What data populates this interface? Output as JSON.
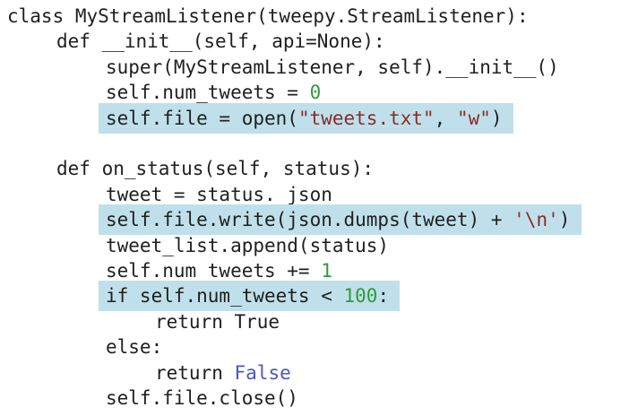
{
  "code": {
    "lines": [
      {
        "indent": 0,
        "parts": [
          {
            "t": "class MyStreamListener(tweepy.StreamListener):",
            "c": ""
          }
        ]
      },
      {
        "indent": 1,
        "parts": [
          {
            "t": "def __init__(self, api=None):",
            "c": ""
          }
        ]
      },
      {
        "indent": 2,
        "parts": [
          {
            "t": "super(MyStreamListener, self).__init__()",
            "c": ""
          }
        ]
      },
      {
        "indent": 2,
        "parts": [
          {
            "t": "self.num_tweets = ",
            "c": ""
          },
          {
            "t": "0",
            "c": "num"
          }
        ]
      },
      {
        "indent": 2,
        "parts": [
          {
            "t": "self.file = open(",
            "c": ""
          },
          {
            "t": "\"tweets.txt\"",
            "c": "str"
          },
          {
            "t": ", ",
            "c": ""
          },
          {
            "t": "\"w\"",
            "c": "str"
          },
          {
            "t": ")",
            "c": ""
          }
        ]
      },
      {
        "indent": 0,
        "parts": [
          {
            "t": "",
            "c": ""
          }
        ]
      },
      {
        "indent": 1,
        "parts": [
          {
            "t": "def on_status(self, status):",
            "c": ""
          }
        ]
      },
      {
        "indent": 2,
        "parts": [
          {
            "t": "tweet = status._json",
            "c": ""
          }
        ]
      },
      {
        "indent": 2,
        "parts": [
          {
            "t": "self.file.write(json.dumps(tweet) + ",
            "c": ""
          },
          {
            "t": "'\\n'",
            "c": "str"
          },
          {
            "t": ")",
            "c": ""
          }
        ]
      },
      {
        "indent": 2,
        "parts": [
          {
            "t": "tweet_list.append(status)",
            "c": ""
          }
        ]
      },
      {
        "indent": 2,
        "parts": [
          {
            "t": "self.num_tweets += ",
            "c": ""
          },
          {
            "t": "1",
            "c": "num"
          }
        ]
      },
      {
        "indent": 2,
        "parts": [
          {
            "t": "if self.num_tweets < ",
            "c": ""
          },
          {
            "t": "100",
            "c": "num"
          },
          {
            "t": ":",
            "c": ""
          }
        ]
      },
      {
        "indent": 3,
        "parts": [
          {
            "t": "return True",
            "c": ""
          }
        ]
      },
      {
        "indent": 2,
        "parts": [
          {
            "t": "else:",
            "c": ""
          }
        ]
      },
      {
        "indent": 3,
        "parts": [
          {
            "t": "return ",
            "c": ""
          },
          {
            "t": "False",
            "c": "bool"
          }
        ]
      },
      {
        "indent": 2,
        "parts": [
          {
            "t": "self.file.close()",
            "c": ""
          }
        ]
      }
    ],
    "highlighted_lines": [
      4,
      8,
      11
    ],
    "highlight_color": "#bfe0ea",
    "colors": {
      "text": "#1f1f1f",
      "number": "#2f9a38",
      "string": "#8a2b2b",
      "boolean": "#4b55c8"
    }
  }
}
